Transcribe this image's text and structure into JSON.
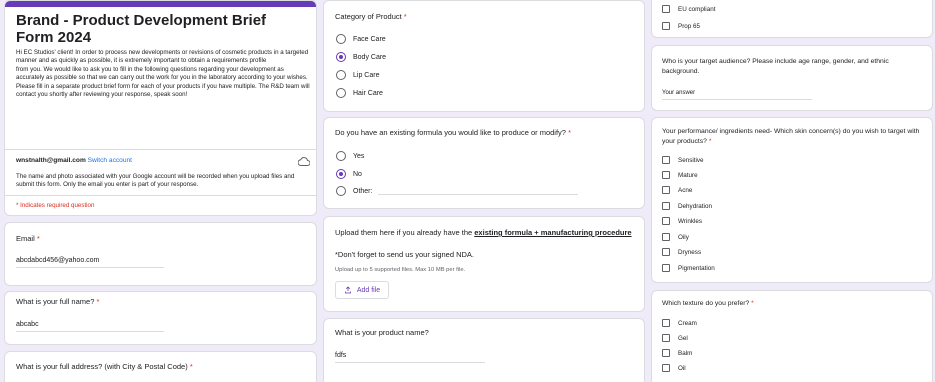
{
  "form": {
    "title": "Brand - Product Development Brief Form 2024",
    "description": "Hi EC Studios' client! In order to process new developments or revisions of cosmetic products in a targeted manner and as quickly as possible, it is extremely important to obtain a requirements profile\nfrom you. We would like to ask you to fill in the following questions regarding your development as\naccurately as possible so that we can carry out the work for you in the laboratory according to your wishes. Please fill in a separate product brief form for each of your products if you have multiple. The R&D team will contact you shortly after reviewing your response, speak soon!",
    "account_email": "wnstnalth@gmail.com",
    "switch_account": "Switch account",
    "privacy_note": "The name and photo associated with your Google account will be recorded when you upload files and submit this form. Only the email you enter is part of your response.",
    "required_note": "* Indicates required question",
    "accent": "#673ab7",
    "background": "#f0ebf8"
  },
  "email_q": {
    "label": "Email",
    "asterisk": "*",
    "value": "abcdabcd456@yahoo.com"
  },
  "name_q": {
    "label": "What is your full name?",
    "asterisk": "*",
    "value": "abcabc"
  },
  "address_q": {
    "label": "What is your full address? (with City & Postal Code)",
    "asterisk": "*"
  },
  "category_q": {
    "label": "Category of Product",
    "asterisk": "*",
    "options": [
      "Face Care",
      "Body Care",
      "Lip Care",
      "Hair Care"
    ],
    "selected": "Body Care"
  },
  "formula_q": {
    "label": "Do you have an existing formula you would like to produce or modify?",
    "asterisk": "*",
    "options": [
      "Yes",
      "No",
      "Other:"
    ],
    "selected": "No"
  },
  "upload_q": {
    "label_prefix": "Upload them here if you already have the ",
    "label_link": "existing formula + manufacturing procedure",
    "nda_note": "*Don't forget to send us your signed NDA.",
    "limits": "Upload up to 5 supported files. Max 10 MB per file.",
    "button": "Add file"
  },
  "product_name_q": {
    "label": "What is your product name?",
    "value": "fdfs"
  },
  "compliance": {
    "options": [
      "EU compliant",
      "Prop 65"
    ]
  },
  "audience_q": {
    "label": "Who is your target audience? Please include age range, gender, and ethnic background.",
    "placeholder": "Your answer"
  },
  "skin_q": {
    "label": "Your performance/ ingredients need- Which skin concern(s) do you wish to target with your products?",
    "asterisk": "*",
    "options": [
      "Sensitive",
      "Mature",
      "Acne",
      "Dehydration",
      "Wrinkles",
      "Oily",
      "Dryness",
      "Pigmentation"
    ]
  },
  "texture_q": {
    "label": "Which texture do you prefer?",
    "asterisk": "*",
    "options": [
      "Cream",
      "Gel",
      "Balm",
      "Oil"
    ]
  }
}
